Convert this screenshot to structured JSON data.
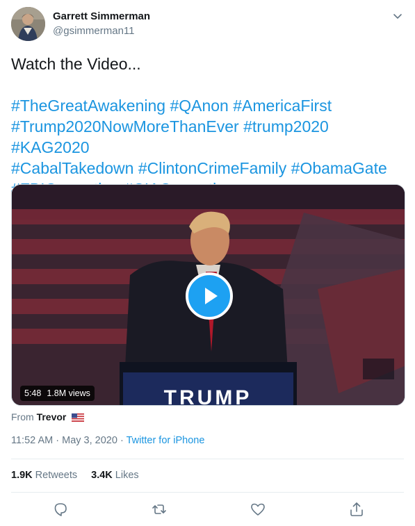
{
  "author": {
    "name": "Garrett Simmerman",
    "handle": "@gsimmerman11"
  },
  "tweet": {
    "text": "Watch the Video...",
    "hashtag_lines": [
      [
        "#TheGreatAwakening",
        "#QAnon",
        "#AmericaFirst"
      ],
      [
        "#Trump2020NowMoreThanEver",
        "#trump2020",
        "#KAG2020"
      ],
      [
        "#CabalTakedown",
        "#ClintonCrimeFamily",
        "#ObamaGate"
      ],
      [
        "#FBICorruption",
        "#CIACorruption"
      ]
    ]
  },
  "video": {
    "duration": "5:48",
    "views": "1.8M views",
    "podium_text": "TRUMP"
  },
  "attribution": {
    "from_label": "From",
    "from_name": "Trevor",
    "flag": "us-flag-icon"
  },
  "meta": {
    "time": "11:52 AM",
    "date": "May 3, 2020",
    "separator": "·",
    "source": "Twitter for iPhone"
  },
  "stats": {
    "retweets_count": "1.9K",
    "retweets_label": "Retweets",
    "likes_count": "3.4K",
    "likes_label": "Likes"
  },
  "actions": [
    "reply-icon",
    "retweet-icon",
    "like-icon",
    "share-icon"
  ],
  "colors": {
    "link": "#1b95e0",
    "muted": "#657786",
    "text": "#14171a",
    "play_button": "#1da1f2",
    "divider": "#e6ecf0"
  }
}
